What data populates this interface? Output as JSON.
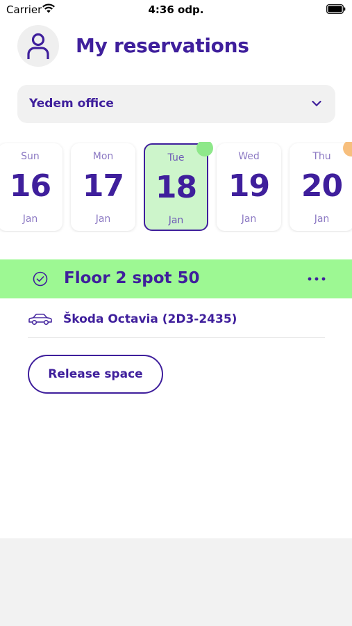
{
  "status_bar": {
    "carrier": "Carrier",
    "time": "4:36 odp."
  },
  "header": {
    "title": "My reservations",
    "avatar_icon": "person-icon"
  },
  "office_select": {
    "value": "Yedem office",
    "icon": "chevron-down-icon"
  },
  "dates": [
    {
      "weekday": "Sun",
      "day": "16",
      "month": "Jan",
      "selected": false,
      "indicator": null
    },
    {
      "weekday": "Mon",
      "day": "17",
      "month": "Jan",
      "selected": false,
      "indicator": null
    },
    {
      "weekday": "Tue",
      "day": "18",
      "month": "Jan",
      "selected": true,
      "indicator": "#8ee88a"
    },
    {
      "weekday": "Wed",
      "day": "19",
      "month": "Jan",
      "selected": false,
      "indicator": null
    },
    {
      "weekday": "Thu",
      "day": "20",
      "month": "Jan",
      "selected": false,
      "indicator": "#f7bf7d"
    }
  ],
  "reservation": {
    "title": "Floor 2 spot 50",
    "status_icon": "check-circle-icon",
    "menu_icon": "more-icon",
    "car_icon": "car-icon",
    "car": "Škoda Octavia (2D3-2435)",
    "release_label": "Release space"
  },
  "colors": {
    "brand": "#3f1f9c",
    "reserved_bar": "#9df893",
    "selected_day": "#cdf5cb"
  }
}
